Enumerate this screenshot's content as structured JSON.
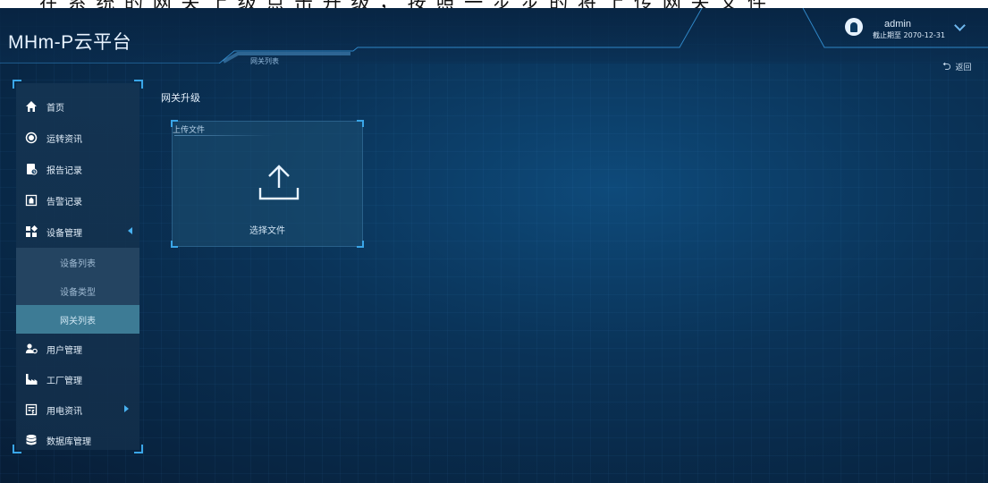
{
  "document_strip": {
    "text": "在 系 统 的 网 关 上 级 点 击 升 级 ， 按 照 一 步 步 的 将 上 传 网 关 文 件"
  },
  "app": {
    "title": "MHm-P云平台"
  },
  "header": {
    "tab_label": "网关列表",
    "user": {
      "name": "admin",
      "expiry": "截止期至 2070-12-31"
    },
    "back_label": "返回"
  },
  "sidebar": {
    "items": [
      {
        "label": "首页",
        "icon": "home-icon"
      },
      {
        "label": "运转资讯",
        "icon": "record-icon"
      },
      {
        "label": "报告记录",
        "icon": "report-icon"
      },
      {
        "label": "告警记录",
        "icon": "alarm-icon"
      },
      {
        "label": "设备管理",
        "icon": "grid-icon"
      },
      {
        "label": "用户管理",
        "icon": "users-icon"
      },
      {
        "label": "工厂管理",
        "icon": "factory-icon"
      },
      {
        "label": "用电资讯",
        "icon": "meter-icon"
      },
      {
        "label": "数据库管理",
        "icon": "database-icon"
      }
    ],
    "sub_items": [
      {
        "label": "设备列表"
      },
      {
        "label": "设备类型"
      },
      {
        "label": "网关列表"
      }
    ]
  },
  "main": {
    "section_title": "网关升级",
    "upload": {
      "label": "上传文件",
      "choose_label": "选择文件",
      "icon": "upload-icon"
    }
  },
  "colors": {
    "background": "#0a3358",
    "accent": "#3aa6e8",
    "active_sub": "#3d7b95"
  }
}
